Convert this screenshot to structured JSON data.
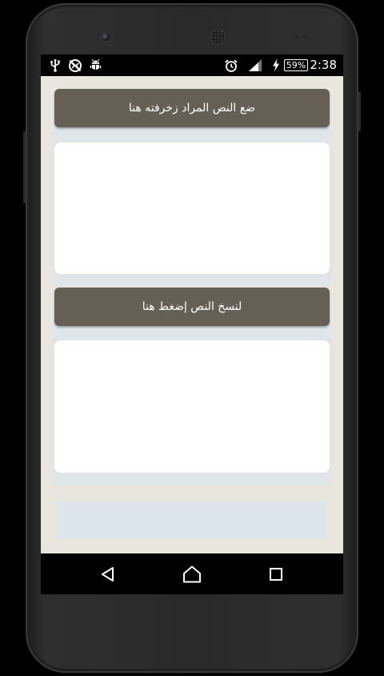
{
  "status_bar": {
    "left_icons": [
      "usb-icon",
      "no-sync-icon",
      "android-debug-icon"
    ],
    "right_icons": [
      "alarm-icon",
      "signal-icon",
      "charging-icon",
      "battery-icon"
    ],
    "battery": "59%",
    "time": "2:38"
  },
  "app": {
    "input_header": "ضع النص المراد زخرفته هنا",
    "input_text": "",
    "output_header": "لنسخ النص إضغط هنا",
    "output_text": ""
  },
  "nav_bar": {
    "buttons": [
      "back-icon",
      "home-icon",
      "recents-icon"
    ]
  },
  "colors": {
    "header_bg": "#655f56",
    "app_bg": "#e8e6dd",
    "panel_bg": "#dfe6ea",
    "textbox_bg": "#ffffff"
  }
}
